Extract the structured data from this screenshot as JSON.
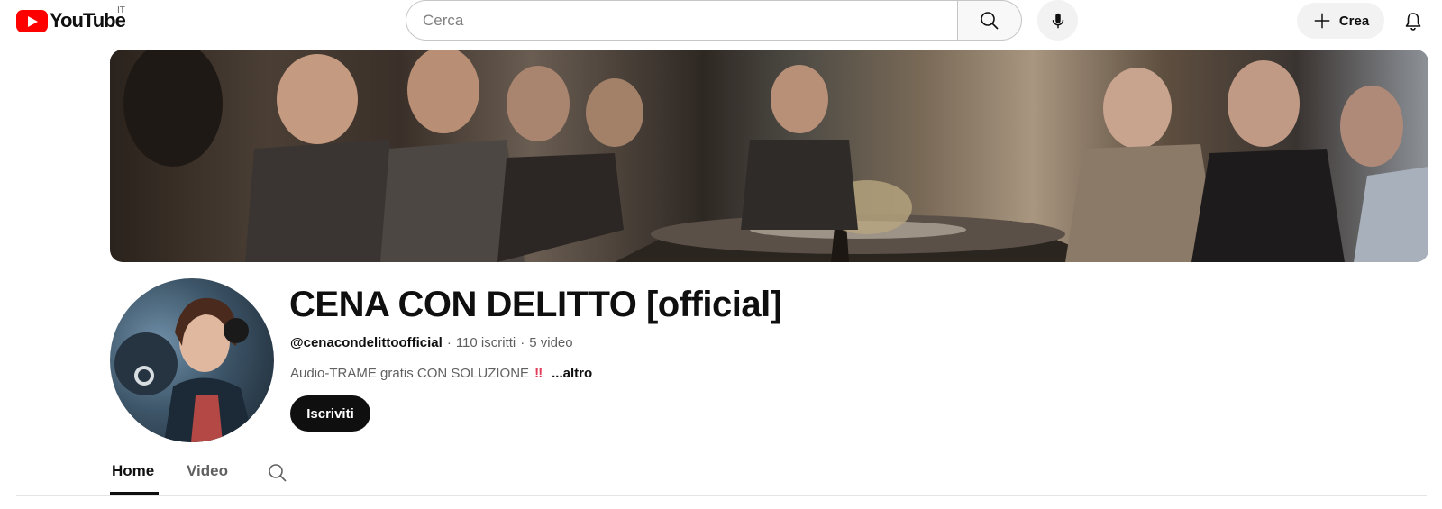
{
  "header": {
    "logo_text": "YouTube",
    "country_code": "IT",
    "search_placeholder": "Cerca",
    "search_icon": "search-icon",
    "mic_icon": "mic-icon",
    "create_label": "Crea",
    "create_icon": "plus-icon",
    "notifications_icon": "bell-icon"
  },
  "channel": {
    "title": "CENA CON DELITTO [official]",
    "handle": "@cenacondelittoofficial",
    "subscribers": "110 iscritti",
    "videos": "5 video",
    "separator": "·",
    "description": "Audio-TRAME gratis CON SOLUZIONE",
    "description_emoji": "‼",
    "more_label": "...altro",
    "subscribe_label": "Iscriviti"
  },
  "tabs": [
    {
      "label": "Home",
      "active": true
    },
    {
      "label": "Video",
      "active": false
    }
  ],
  "colors": {
    "brand_red": "#ff0000",
    "text_primary": "#0f0f0f",
    "text_secondary": "#606060"
  }
}
